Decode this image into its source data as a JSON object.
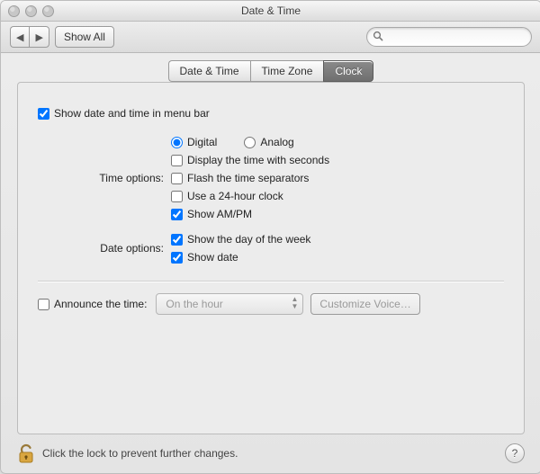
{
  "window": {
    "title": "Date & Time"
  },
  "toolbar": {
    "showall_label": "Show All",
    "search_placeholder": ""
  },
  "tabs": {
    "items": [
      {
        "label": "Date & Time"
      },
      {
        "label": "Time Zone"
      },
      {
        "label": "Clock"
      }
    ],
    "selected_index": 2
  },
  "clock": {
    "menubar_label": "Show date and time in menu bar",
    "menubar_checked": true,
    "time_options_label": "Time options:",
    "digital_label": "Digital",
    "analog_label": "Analog",
    "time_format_selected": "digital",
    "display_seconds_label": "Display the time with seconds",
    "display_seconds_checked": false,
    "flash_separators_label": "Flash the time separators",
    "flash_separators_checked": false,
    "use_24h_label": "Use a 24-hour clock",
    "use_24h_checked": false,
    "show_ampm_label": "Show AM/PM",
    "show_ampm_checked": true,
    "date_options_label": "Date options:",
    "show_day_label": "Show the day of the week",
    "show_day_checked": true,
    "show_date_label": "Show date",
    "show_date_checked": true,
    "announce_label": "Announce the time:",
    "announce_checked": false,
    "announce_interval": "On the hour",
    "customize_voice_label": "Customize Voice…"
  },
  "footer": {
    "lock_text": "Click the lock to prevent further changes.",
    "help_label": "?"
  }
}
